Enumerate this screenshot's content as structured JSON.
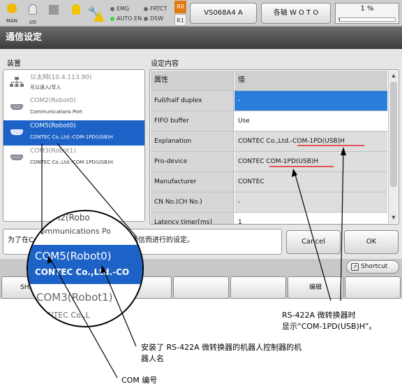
{
  "status_bar": {
    "man_label": "MAN",
    "io_label": "I/O",
    "lamps": {
      "emg": "EMG",
      "auto_en": "AUTO EN",
      "frtct": "FRTCT",
      "dsw": "DSW"
    },
    "r0": "R0",
    "r1": "R1",
    "robot_button": "VS068A4 A",
    "axis_button": "各轴 W O T O",
    "speed_text": "1 %",
    "speed_percent": 1
  },
  "window": {
    "title": "通信设定"
  },
  "device_section": {
    "label": "装置",
    "items": [
      {
        "line1": "以太网(10.4.113.90)",
        "line2": "可以读入/写入",
        "icon": "network-icon",
        "selected": false
      },
      {
        "line1": "COM2(Robot0)",
        "line2": "Communications Port",
        "icon": "serial-port-icon",
        "selected": false
      },
      {
        "line1": "COM5(Robot0)",
        "line2": "CONTEC Co.,Ltd.-COM-1PD(USB)H",
        "icon": "serial-port-icon",
        "selected": true
      },
      {
        "line1": "COM3(Robot1)",
        "line2": "CONTEC Co.,Ltd.-COM-1PD(USB)H",
        "icon": "serial-port-icon",
        "selected": false
      }
    ]
  },
  "settings_section": {
    "label": "设定内容",
    "header": {
      "key": "属性",
      "value": "值"
    },
    "rows": [
      {
        "key": "Full/half duplex",
        "value": "-"
      },
      {
        "key": "FIFO buffer",
        "value": "Use"
      },
      {
        "key": "Explanation",
        "value": "CONTEC Co.,Ltd.-COM-1PD(USB)H"
      },
      {
        "key": "Pro-device",
        "value": "CONTEC COM-1PD(USB)H"
      },
      {
        "key": "Manufacturer",
        "value": "CONTEC"
      },
      {
        "key": "CN No.(CH No.)",
        "value": "-"
      },
      {
        "key": "Latency timer[ms]",
        "value": "1"
      }
    ]
  },
  "message": "为了在Communications Port之间进行通信而进行的设定。",
  "buttons": {
    "cancel": "Cancel",
    "ok": "OK",
    "shortcut": "Shortcut"
  },
  "function_keys": [
    "SHIFT",
    "",
    "",
    "",
    "",
    "编辑",
    ""
  ],
  "magnifier": {
    "ghost_top": "M2(Robo",
    "ghost_sub": "Communications Po",
    "sel_line1": "COM5(Robot0)",
    "sel_line2": "CONTEC Co.,Ltd.-CO",
    "next_line1": "COM3(Robot1)",
    "next_line2": "CONTEC Co.,L"
  },
  "annotations": {
    "converter_note_line1": "RS-422A 微转换器时",
    "converter_note_line2": "显示“COM-1PD(USB)H”。",
    "robot_name_note_line1": "安装了 RS-422A 微转换器的机器人控制器的机",
    "robot_name_note_line2": "器人名",
    "com_no_note": "COM 编号"
  }
}
